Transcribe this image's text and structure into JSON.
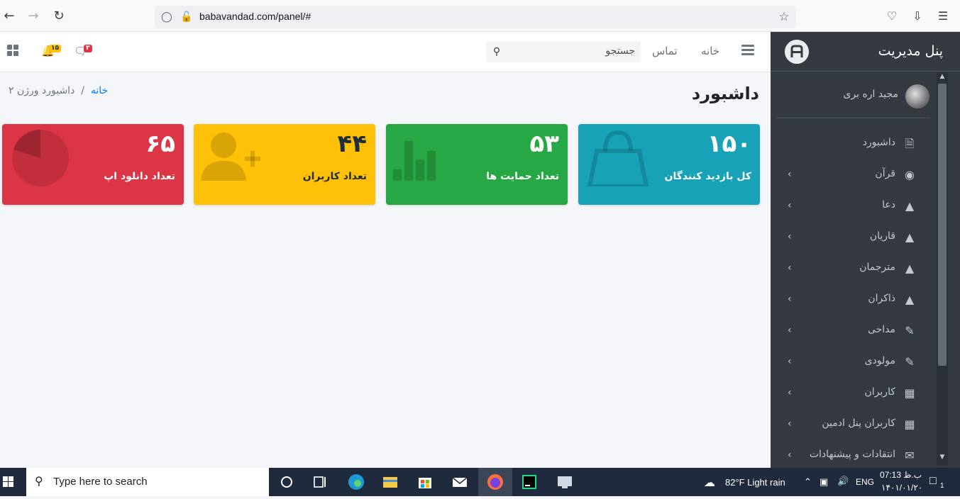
{
  "browser": {
    "url": "babavandad.com/panel/#"
  },
  "navbar": {
    "home_label": "خانه",
    "contact_label": "تماس",
    "search_placeholder": "جستجو",
    "notif_count": "۱۵",
    "msg_count": "۳"
  },
  "content": {
    "title": "داشبورد",
    "breadcrumb_home": "خانه",
    "breadcrumb_sep": "/",
    "breadcrumb_current": "داشبورد ورژن ۲"
  },
  "cards": [
    {
      "value": "۱۵۰",
      "label": "کل بازدید کنندگان",
      "color": "#17a2b8",
      "icon": "shopping-bag-icon"
    },
    {
      "value": "۵۳",
      "label": "تعداد حمایت ها",
      "color": "#28a745",
      "icon": "bar-chart-icon"
    },
    {
      "value": "۴۴",
      "label": "تعداد کاربران",
      "color": "#ffc107",
      "icon": "user-plus-icon"
    },
    {
      "value": "۶۵",
      "label": "تعداد دانلود اپ",
      "color": "#dc3545",
      "icon": "pie-chart-icon"
    }
  ],
  "sidebar": {
    "brand": "پنل مدیریت",
    "user_name": "مجید اره بری",
    "items": [
      {
        "label": "داشبورد",
        "icon": "file-icon",
        "has_children": false
      },
      {
        "label": "قرآن",
        "icon": "dashboard-icon",
        "has_children": true
      },
      {
        "label": "دعا",
        "icon": "tree-icon",
        "has_children": true
      },
      {
        "label": "قاریان",
        "icon": "tree-icon",
        "has_children": true
      },
      {
        "label": "مترجمان",
        "icon": "tree-icon",
        "has_children": true
      },
      {
        "label": "ذاکران",
        "icon": "tree-icon",
        "has_children": true
      },
      {
        "label": "مداحی",
        "icon": "edit-icon",
        "has_children": true
      },
      {
        "label": "مولودی",
        "icon": "edit-icon",
        "has_children": true
      },
      {
        "label": "کاربران",
        "icon": "table-icon",
        "has_children": true
      },
      {
        "label": "کاربران پنل ادمین",
        "icon": "table-icon",
        "has_children": true
      },
      {
        "label": "انتقادات و پیشنهادات",
        "icon": "envelope-icon",
        "has_children": true
      }
    ]
  },
  "taskbar": {
    "search_placeholder": "Type here to search",
    "weather": "82°F  Light rain",
    "lang": "ENG",
    "time": "07:13 ب.ظ",
    "date": "۱۴۰۱/۰۱/۲۰",
    "notif_count": "1"
  }
}
